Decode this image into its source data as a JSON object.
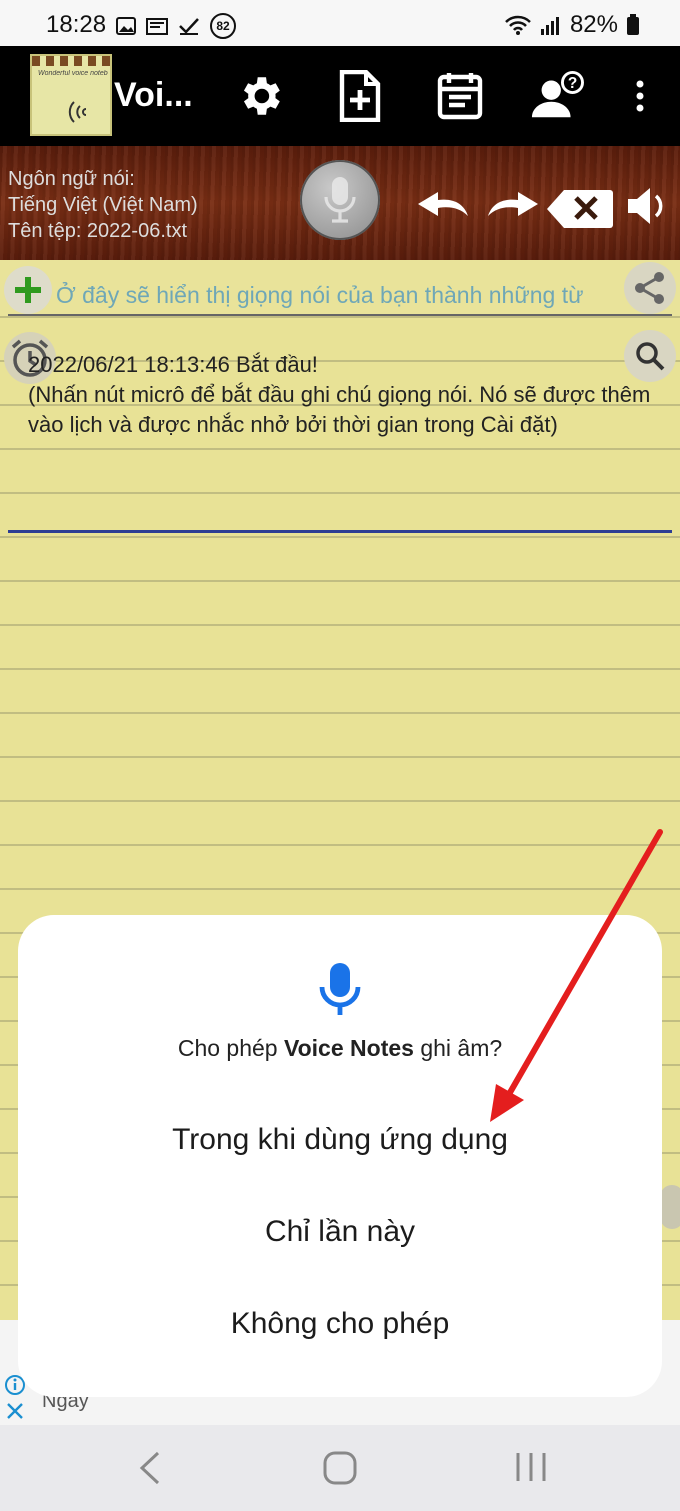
{
  "status": {
    "time": "18:28",
    "notif_count": "82",
    "battery": "82%"
  },
  "appbar": {
    "title": "Voi...",
    "logo_text": "Wonderful voice notebook"
  },
  "lang_panel": {
    "line1": "Ngôn ngữ nói:",
    "line2": "Tiếng Việt (Việt Nam)",
    "line3": "Tên tệp: 2022-06.txt"
  },
  "editor": {
    "placeholder": "Ở đây sẽ hiển thị giọng nói của bạn thành những từ",
    "note_line1": "2022/06/21 18:13:46 Bắt đầu!",
    "note_line2": "(Nhấn nút micrô để bắt đầu ghi chú giọng nói. Nó sẽ được thêm vào lịch và được nhắc nhở bởi thời gian trong Cài đặt)"
  },
  "ad": {
    "text": "Ngày"
  },
  "dialog": {
    "title_pre": "Cho phép ",
    "title_app": "Voice Notes",
    "title_post": " ghi âm?",
    "option1": "Trong khi dùng ứng dụng",
    "option2": "Chỉ lần này",
    "option3": "Không cho phép"
  },
  "colors": {
    "accent_blue": "#1a73e8",
    "arrow_red": "#e41e1e",
    "wood": "#6b2610",
    "paper": "#e8e296"
  }
}
